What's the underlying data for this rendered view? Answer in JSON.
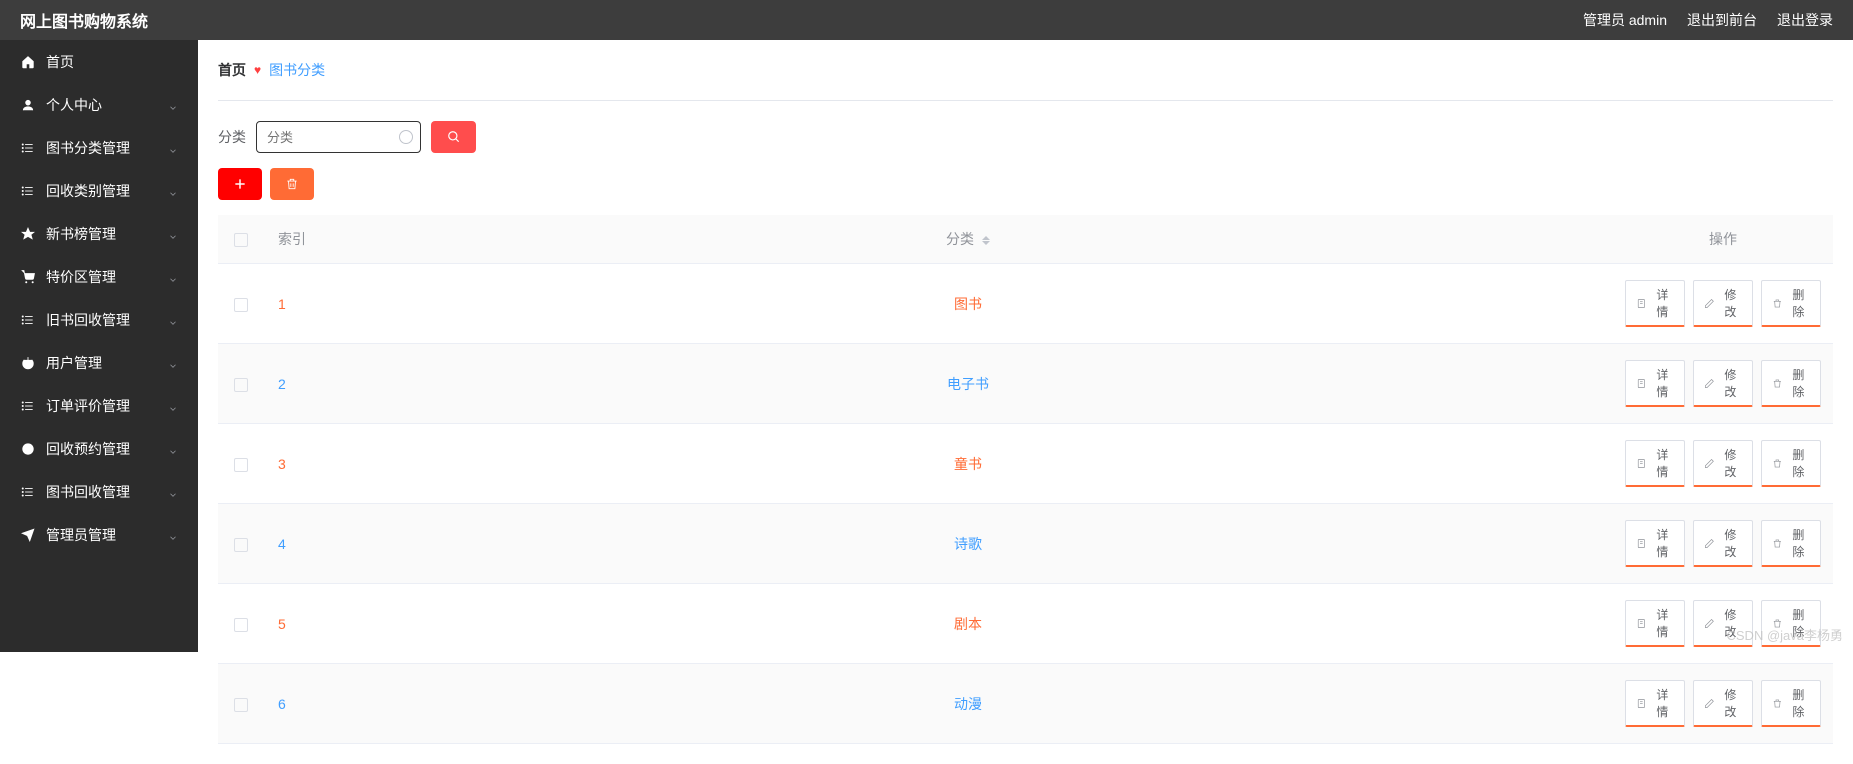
{
  "header": {
    "title": "网上图书购物系统",
    "admin_label": "管理员 admin",
    "logout_front": "退出到前台",
    "logout": "退出登录"
  },
  "sidebar": {
    "items": [
      {
        "label": "首页",
        "icon": "home",
        "expandable": false
      },
      {
        "label": "个人中心",
        "icon": "user",
        "expandable": true
      },
      {
        "label": "图书分类管理",
        "icon": "list",
        "expandable": true
      },
      {
        "label": "回收类别管理",
        "icon": "list",
        "expandable": true
      },
      {
        "label": "新书榜管理",
        "icon": "pin",
        "expandable": true
      },
      {
        "label": "特价区管理",
        "icon": "basket",
        "expandable": true
      },
      {
        "label": "旧书回收管理",
        "icon": "list",
        "expandable": true
      },
      {
        "label": "用户管理",
        "icon": "power",
        "expandable": true
      },
      {
        "label": "订单评价管理",
        "icon": "list",
        "expandable": true
      },
      {
        "label": "回收预约管理",
        "icon": "clock",
        "expandable": true
      },
      {
        "label": "图书回收管理",
        "icon": "list",
        "expandable": true
      },
      {
        "label": "管理员管理",
        "icon": "send",
        "expandable": true
      }
    ]
  },
  "breadcrumb": {
    "home": "首页",
    "current": "图书分类"
  },
  "filter": {
    "label": "分类",
    "placeholder": "分类"
  },
  "table": {
    "headers": {
      "index": "索引",
      "category": "分类",
      "action": "操作"
    },
    "rows": [
      {
        "index": "1",
        "category": "图书"
      },
      {
        "index": "2",
        "category": "电子书"
      },
      {
        "index": "3",
        "category": "童书"
      },
      {
        "index": "4",
        "category": "诗歌"
      },
      {
        "index": "5",
        "category": "剧本"
      },
      {
        "index": "6",
        "category": "动漫"
      }
    ],
    "actions": {
      "detail": "详情",
      "edit": "修改",
      "delete": "删除"
    }
  },
  "watermark": "CSDN @java李杨勇"
}
